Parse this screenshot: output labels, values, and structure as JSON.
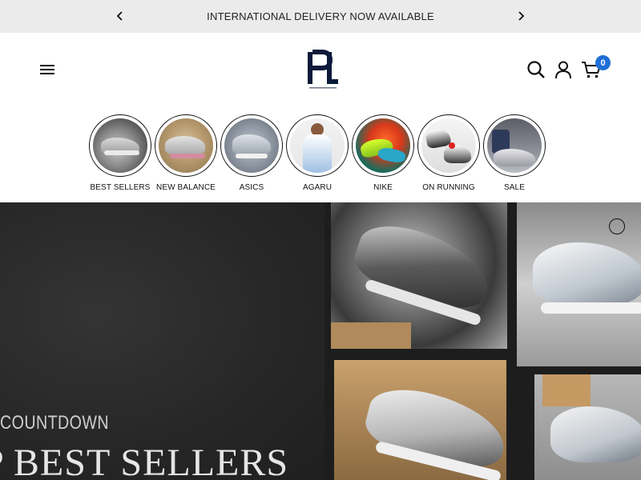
{
  "announcement": {
    "text": "INTERNATIONAL DELIVERY NOW AVAILABLE",
    "prev_icon": "chevron-left-icon",
    "next_icon": "chevron-right-icon"
  },
  "header": {
    "logo_alt": "PL",
    "cart_count": "0",
    "icons": [
      "menu-icon",
      "search-icon",
      "account-icon",
      "cart-icon"
    ]
  },
  "categories": [
    {
      "label": "BEST SELLERS"
    },
    {
      "label": "NEW BALANCE"
    },
    {
      "label": "ASICS"
    },
    {
      "label": "AGARU"
    },
    {
      "label": "NIKE"
    },
    {
      "label": "ON RUNNING"
    },
    {
      "label": "SALE"
    }
  ],
  "hero": {
    "kicker": "COUNTDOWN",
    "title": "P BEST SELLERS"
  },
  "colors": {
    "accent": "#1f6fd6",
    "announcement_bg": "#ebebeb",
    "hero_bg": "#2a2a2a"
  }
}
